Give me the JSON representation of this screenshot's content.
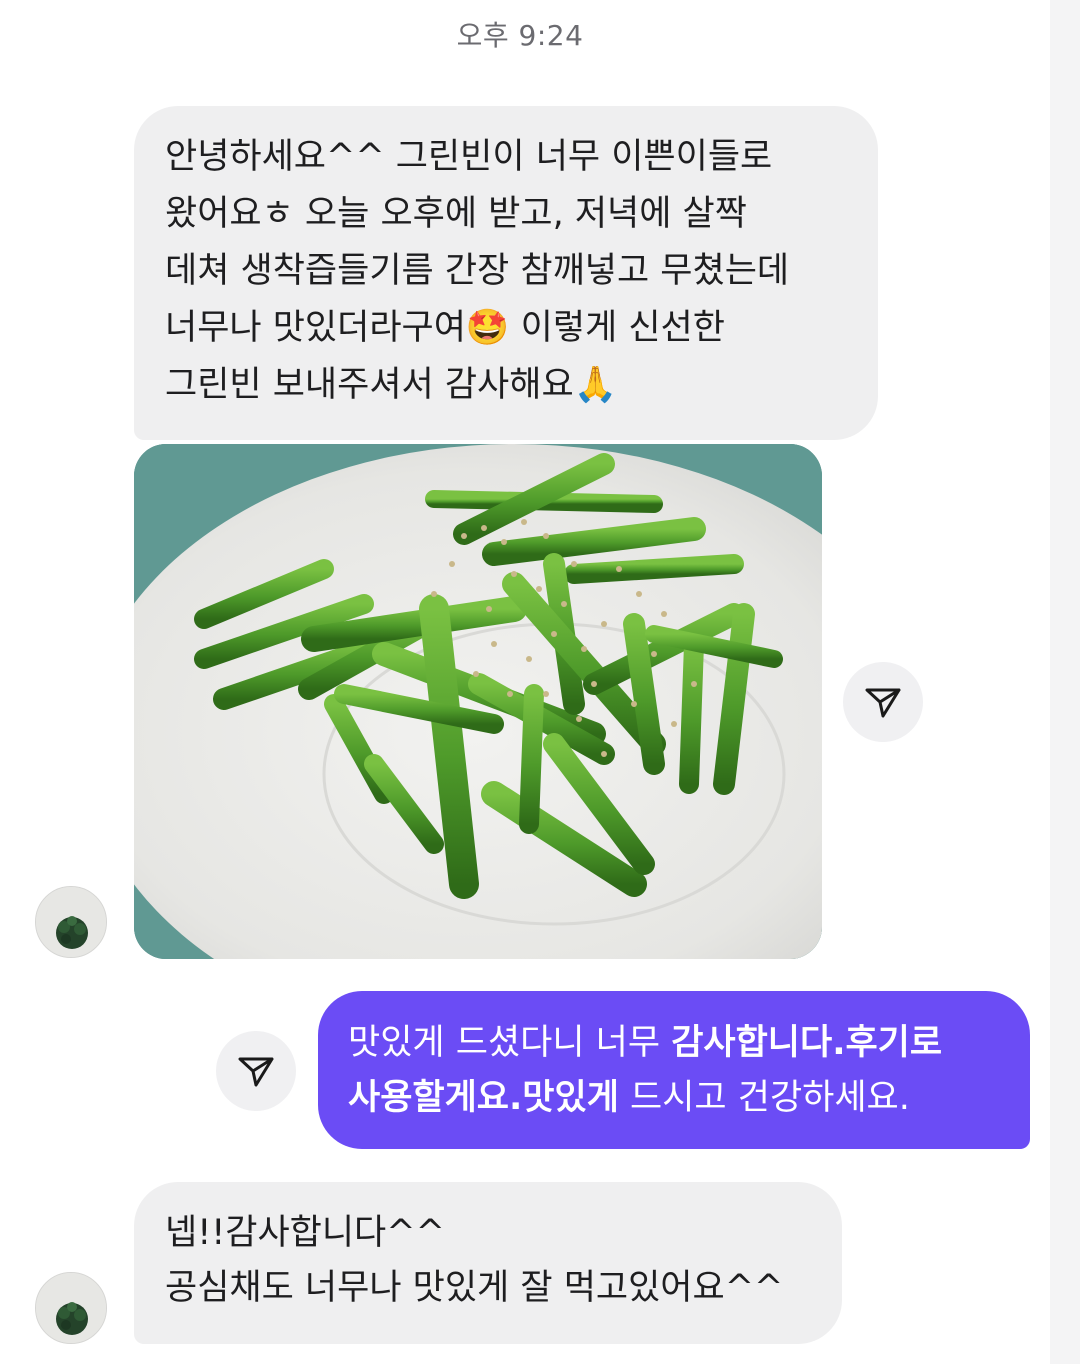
{
  "chat": {
    "timestamp": "오후 9:24",
    "messages": [
      {
        "direction": "incoming",
        "text": "안녕하세요^^  그린빈이 너무 이쁜이들로\n왔어요ㅎ 오늘 오후에 받고, 저녁에 살짝\n데쳐 생착즙들기름 간장 참깨넣고 무쳤는데\n너무나 맛있더라구여🤩  이렇게 신선한\n그린빈 보내주셔서 감사해요🙏"
      },
      {
        "direction": "outgoing",
        "text_parts": [
          "맛있게 드셨다니 너무 ",
          "감사합니다.후기로\n사용할게요.맛있게",
          " 드시고 건강하세요."
        ]
      },
      {
        "direction": "incoming",
        "text": "넵!!감사합니다^^\n공심채도 너무나 맛있게 잘 먹고있어요^^"
      }
    ],
    "photo_subject": "seasoned green beans with sesame seeds on a white plate"
  },
  "icons": {
    "share": "share-icon",
    "avatar": "avatar"
  },
  "colors": {
    "incoming_bubble": "#efeff0",
    "outgoing_bubble": "#6b4cf5",
    "timestamp_text": "#6b6b70",
    "share_button_bg": "#f0f0f2"
  }
}
